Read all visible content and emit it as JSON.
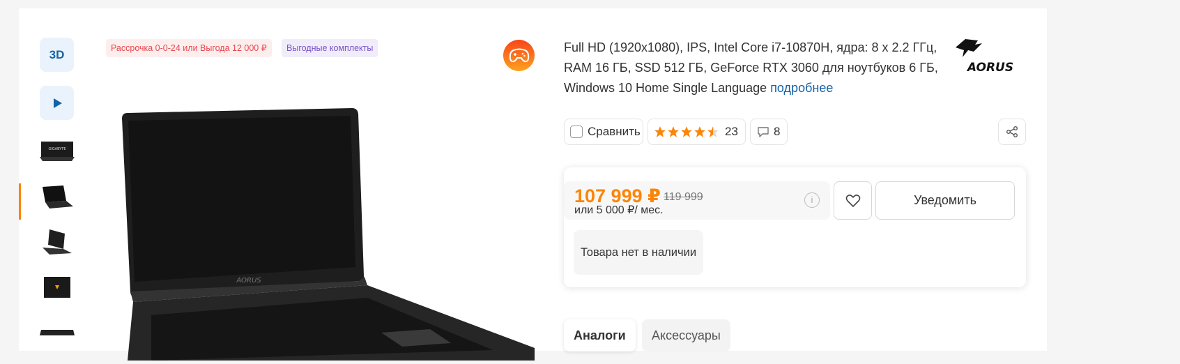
{
  "gallery": {
    "btn_3d_label": "3D",
    "thumbnails": [
      "laptop-front-closed",
      "laptop-open-side",
      "laptop-open-back",
      "laptop-top",
      "laptop-closed"
    ]
  },
  "badges": {
    "installment": "Рассрочка 0-0-24 или Выгода 12 000 ₽",
    "kits": "Выгодные комплекты"
  },
  "brand": {
    "logo_text": "AORUS",
    "laptop_brand_text": "GIGABYTE"
  },
  "description": {
    "text": "Full HD (1920x1080), IPS, Intel Core i7-10870H, ядра: 8 х 2.2 ГГц, RAM 16 ГБ, SSD 512 ГБ, GeForce RTX 3060 для ноутбуков 6 ГБ, Windows 10 Home Single Language ",
    "more_link": "подробнее"
  },
  "actions": {
    "compare_label": "Сравнить",
    "rating_value": 4.5,
    "rating_count": "23",
    "comments_count": "8"
  },
  "price": {
    "current": "107 999 ₽",
    "old": "119 999",
    "credit": "или 5 000 ₽/ мес.",
    "info_glyph": "i",
    "notify_label": "Уведомить",
    "stock_status": "Товара нет в наличии"
  },
  "tabs": [
    {
      "label": "Аналоги",
      "active": true
    },
    {
      "label": "Аксессуары",
      "active": false
    }
  ],
  "colors": {
    "accent_orange": "#fc8507",
    "link_blue": "#1462a8",
    "installment_red": "#e9464c",
    "kits_purple": "#7a52c9"
  }
}
